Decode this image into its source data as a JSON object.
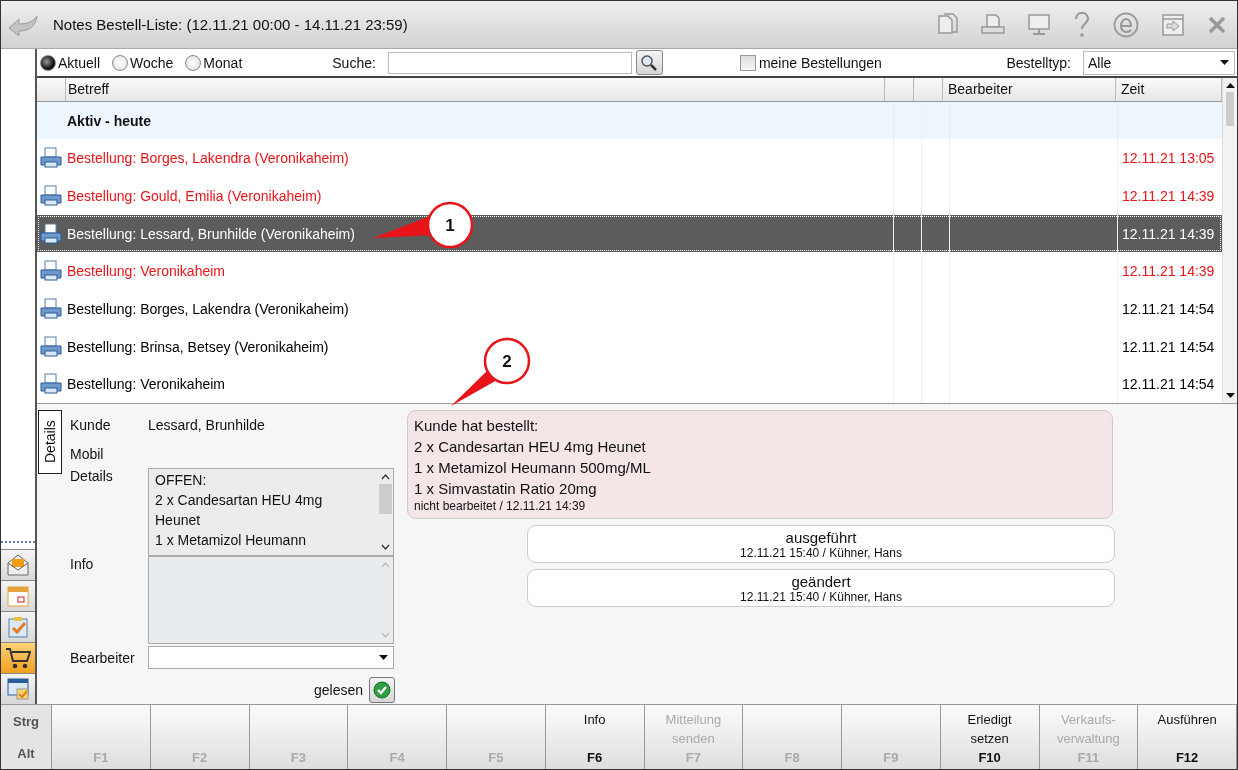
{
  "window": {
    "title": "Notes Bestell-Liste: (12.11.21 00:00 - 14.11.21 23:59)"
  },
  "period": [
    {
      "label": "Aktuell",
      "selected": true
    },
    {
      "label": "Woche",
      "selected": false
    },
    {
      "label": "Monat",
      "selected": false
    }
  ],
  "search": {
    "label": "Suche:"
  },
  "mine": {
    "label": "meine Bestellungen",
    "checked": false
  },
  "order_type": {
    "label": "Bestelltyp:",
    "value": "Alle"
  },
  "table": {
    "columns": [
      "Betreff",
      "Bearbeiter",
      "Zeit"
    ],
    "group": "Aktiv - heute",
    "rows": [
      {
        "subject": "Bestellung: Borges, Lakendra (Veronikaheim)",
        "time": "12.11.21 13:05",
        "color": "#e8141a",
        "selected": false
      },
      {
        "subject": "Bestellung: Gould, Emilia (Veronikaheim)",
        "time": "12.11.21 14:39",
        "color": "#e8141a",
        "selected": false
      },
      {
        "subject": "Bestellung: Lessard, Brunhilde (Veronikaheim)",
        "time": "12.11.21 14:39",
        "color": "#ffffff",
        "selected": true
      },
      {
        "subject": "Bestellung: Veronikaheim",
        "time": "12.11.21 14:39",
        "color": "#e8141a",
        "selected": false
      },
      {
        "subject": "Bestellung: Borges, Lakendra (Veronikaheim)",
        "time": "12.11.21 14:54",
        "color": "#000000",
        "selected": false
      },
      {
        "subject": "Bestellung: Brinsa, Betsey (Veronikaheim)",
        "time": "12.11.21 14:54",
        "color": "#000000",
        "selected": false
      },
      {
        "subject": "Bestellung: Veronikaheim",
        "time": "12.11.21 14:54",
        "color": "#000000",
        "selected": false
      }
    ]
  },
  "details": {
    "tab": "Details",
    "customer_label": "Kunde",
    "customer": "Lessard, Brunhilde",
    "mobile_label": "Mobil",
    "details_label": "Details",
    "details_lines": [
      "OFFEN:",
      "2 x Candesartan HEU 4mg",
      "Heunet",
      "1 x Metamizol Heumann"
    ],
    "info_label": "Info",
    "editor_label": "Bearbeiter",
    "read_label": "gelesen"
  },
  "history": [
    {
      "kind": "order",
      "lines": [
        "Kunde hat bestellt:",
        "2 x Candesartan HEU 4mg Heunet",
        "1 x Metamizol Heumann 500mg/ML",
        "1 x Simvastatin Ratio 20mg"
      ],
      "meta": "nicht bearbeitet / 12.11.21 14:39"
    },
    {
      "kind": "event",
      "lines": [
        "ausgeführt"
      ],
      "meta": "12.11.21 15:40 / Kühner, Hans"
    },
    {
      "kind": "event",
      "lines": [
        "geändert"
      ],
      "meta": "12.11.21 15:40 / Kühner, Hans"
    }
  ],
  "callouts": [
    "1",
    "2"
  ],
  "function_keys": {
    "modifiers": [
      "Strg",
      "Alt"
    ],
    "keys": [
      {
        "key": "F1",
        "disabled": true
      },
      {
        "key": "F2",
        "disabled": true
      },
      {
        "key": "F3",
        "disabled": true
      },
      {
        "key": "F4",
        "disabled": true
      },
      {
        "key": "F5",
        "disabled": true
      },
      {
        "label": "Info",
        "key": "F6",
        "disabled": false
      },
      {
        "label": "Mitteilung senden",
        "key": "F7",
        "disabled": true
      },
      {
        "key": "F8",
        "disabled": true
      },
      {
        "key": "F9",
        "disabled": true
      },
      {
        "label": "Erledigt setzen",
        "key": "F10",
        "disabled": false
      },
      {
        "label": "Verkaufs-verwaltung",
        "key": "F11",
        "disabled": true
      },
      {
        "label": "Ausführen",
        "key": "F12",
        "disabled": false
      }
    ]
  }
}
